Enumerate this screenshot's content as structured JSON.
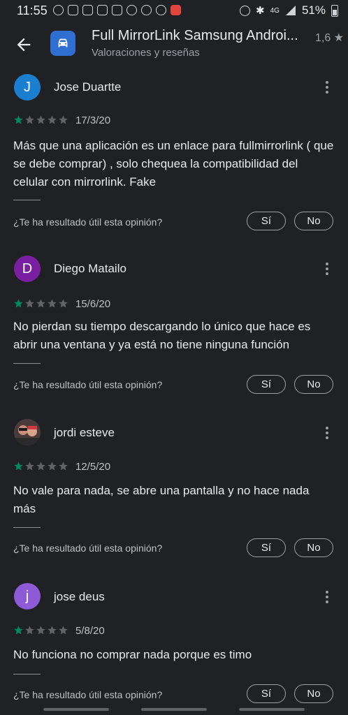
{
  "status_bar": {
    "time": "11:55",
    "network": "4G",
    "battery": "51%"
  },
  "app_bar": {
    "title": "Full MirrorLink Samsung Androi...",
    "subtitle": "Valoraciones y reseñas",
    "rating": "1,6 ★"
  },
  "accent_color": "#01875f",
  "reviews": [
    {
      "avatar_letter": "J",
      "avatar_color": "#1a7fd0",
      "name": "Jose Duartte",
      "rating": 1,
      "date": "17/3/20",
      "text": "Más que una aplicación es un enlace para fullmirrorlink ( que se debe comprar) , solo chequea la compatibilidad del celular con mirrorlink. Fake",
      "helpful_question": "¿Te ha resultado útil esta opinión?",
      "yes_label": "Sí",
      "no_label": "No"
    },
    {
      "avatar_letter": "D",
      "avatar_color": "#7b1fa2",
      "name": "Diego Matailo",
      "rating": 1,
      "date": "15/6/20",
      "text": "No pierdan su tiempo descargando lo único que hace es abrir una ventana y ya está no tiene ninguna función",
      "helpful_question": "¿Te ha resultado útil esta opinión?",
      "yes_label": "Sí",
      "no_label": "No"
    },
    {
      "avatar_letter": "",
      "avatar_color": "#3c3c3c",
      "name": "jordi esteve",
      "rating": 1,
      "date": "12/5/20",
      "text": "No vale para nada, se abre una pantalla y no hace nada más",
      "helpful_question": "¿Te ha resultado útil esta opinión?",
      "yes_label": "Sí",
      "no_label": "No"
    },
    {
      "avatar_letter": "j",
      "avatar_color": "#8e5bd6",
      "name": "jose deus",
      "rating": 1,
      "date": "5/8/20",
      "text": "No funciona no comprar nada porque es timo",
      "helpful_question": "¿Te ha resultado útil esta opinión?",
      "yes_label": "Sí",
      "no_label": "No"
    }
  ]
}
